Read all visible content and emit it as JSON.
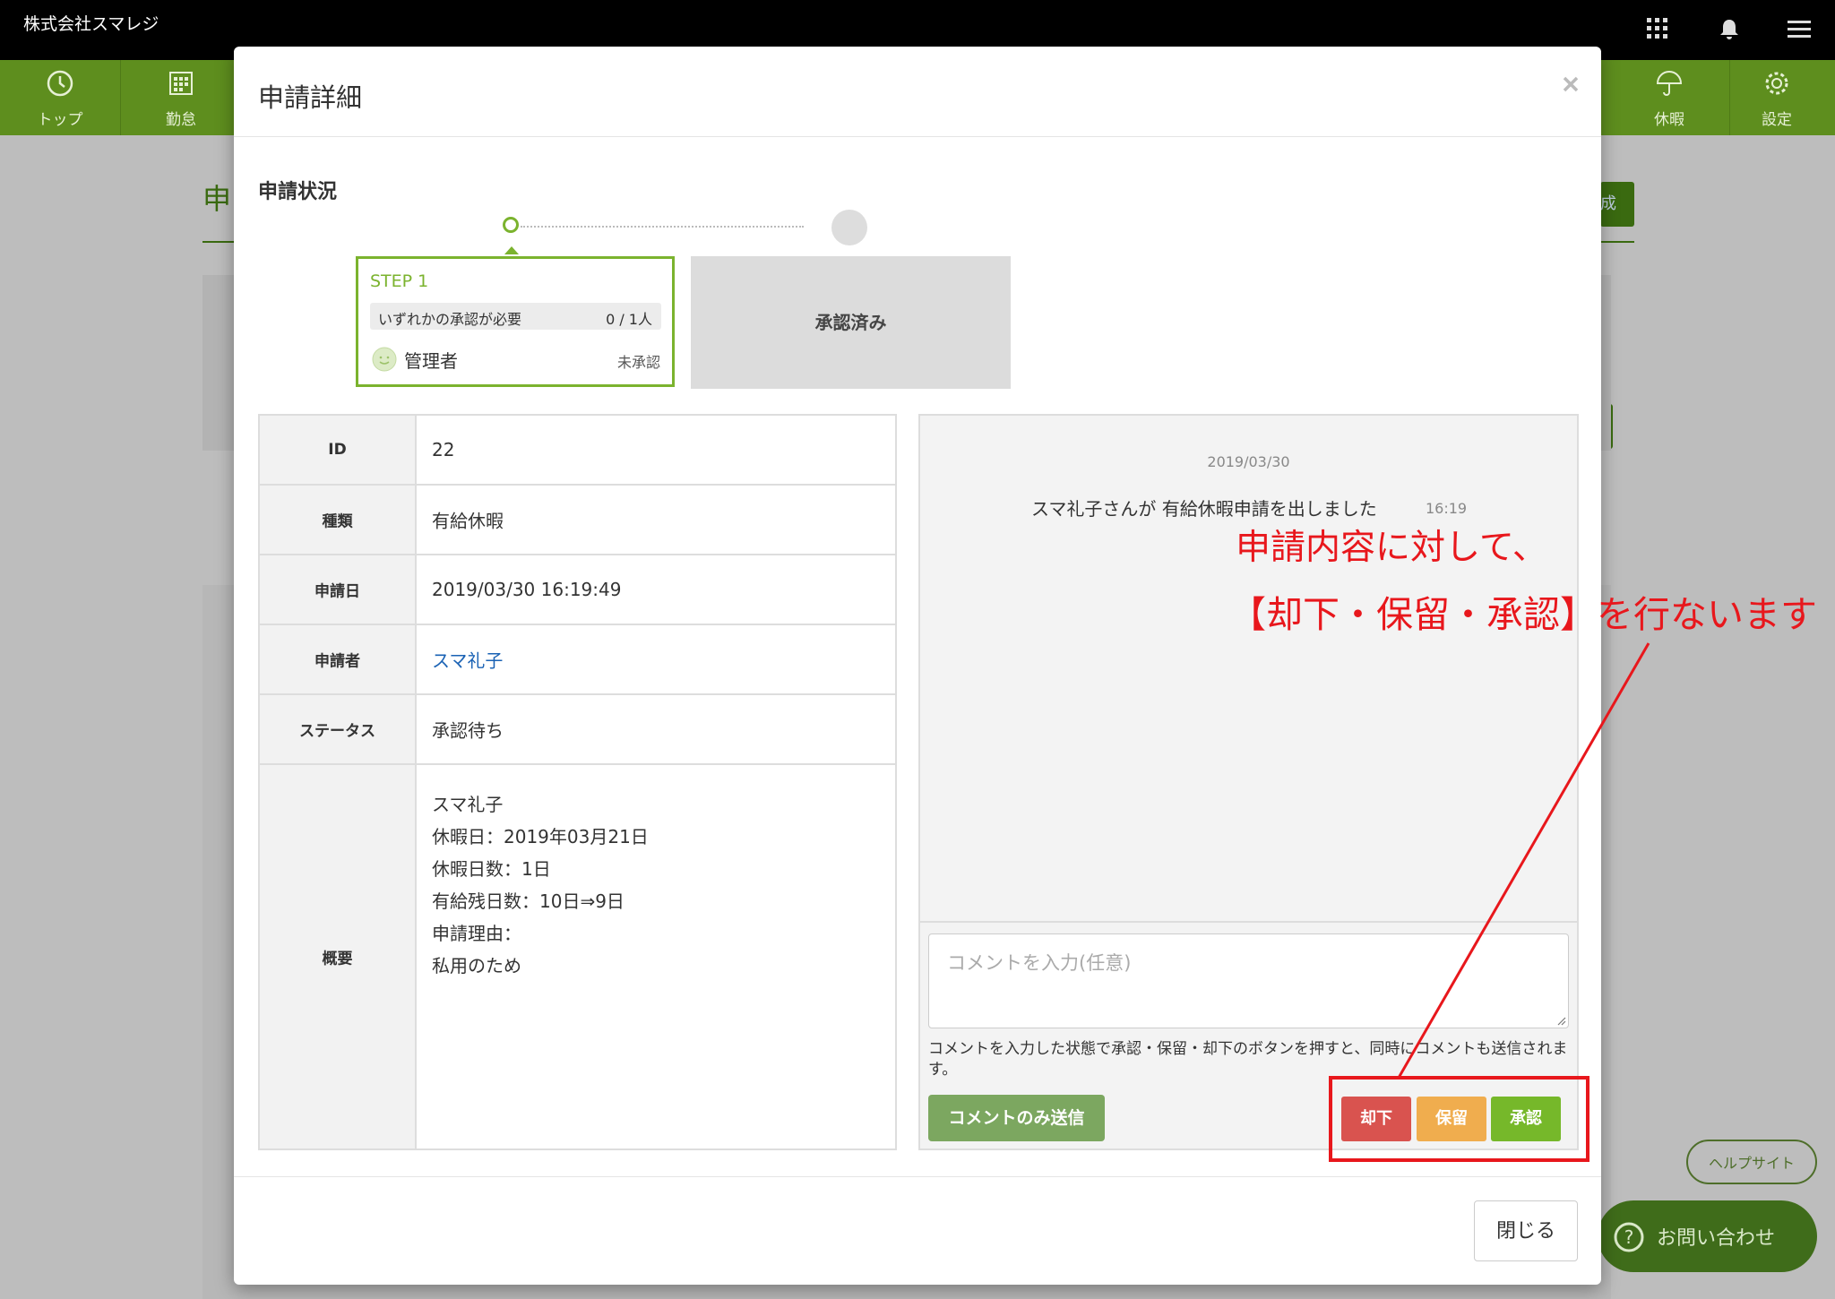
{
  "app": {
    "company": "株式会社スマレジ",
    "nav": [
      {
        "label": "トップ",
        "icon": "clock-icon"
      },
      {
        "label": "勤怠",
        "icon": "calendar-icon"
      },
      {
        "label": "休暇",
        "icon": "umbrella-icon"
      },
      {
        "label": "設定",
        "icon": "gear-icon"
      }
    ],
    "help_label": "ヘルプサイト",
    "contact_label": "お問い合わせ",
    "page_title_fragment": "申",
    "create_fragment": "成"
  },
  "modal": {
    "title": "申請詳細",
    "status_title": "申請状況",
    "step": {
      "label": "STEP 1",
      "requirement": "いずれかの承認が必要",
      "count": "0 / 1人",
      "approver": "管理者",
      "approver_status": "未承認"
    },
    "done_label": "承認済み",
    "details": {
      "id_label": "ID",
      "id_value": "22",
      "type_label": "種類",
      "type_value": "有給休暇",
      "date_label": "申請日",
      "date_value": "2019/03/30 16:19:49",
      "applicant_label": "申請者",
      "applicant_value": "スマ礼子",
      "status_label": "ステータス",
      "status_value": "承認待ち",
      "summary_label": "概要",
      "summary_lines": [
        "スマ礼子",
        "休暇日：2019年03月21日",
        "休暇日数：1日",
        "有給残日数：10日⇒9日",
        "申請理由：",
        "私用のため"
      ]
    },
    "chat": {
      "date": "2019/03/30",
      "message": "スマ礼子さんが 有給休暇申請を出しました",
      "time": "16:19"
    },
    "comment_placeholder": "コメントを入力(任意)",
    "comment_note": "コメントを入力した状態で承認・保留・却下のボタンを押すと、同時にコメントも送信されます。",
    "comment_only_button": "コメントのみ送信",
    "reject_button": "却下",
    "hold_button": "保留",
    "approve_button": "承認",
    "close_button": "閉じる"
  },
  "annotation": {
    "line1": "申請内容に対して、",
    "line2": "【却下・保留・承認】を行ないます",
    "color": "#e8171c"
  }
}
